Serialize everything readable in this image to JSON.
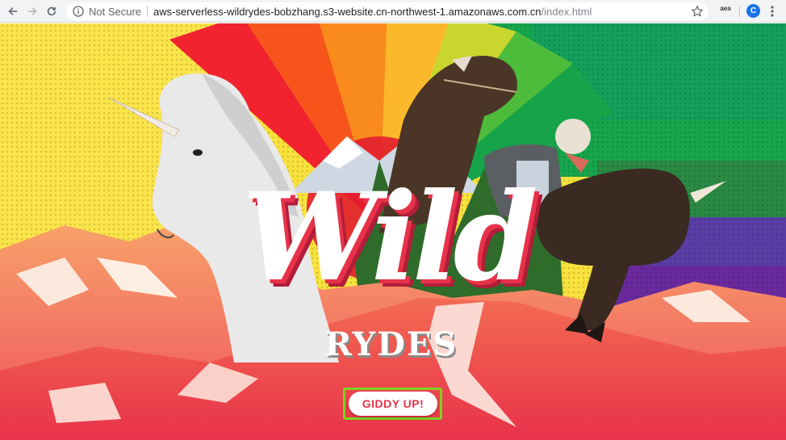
{
  "browser": {
    "security_label": "Not Secure",
    "url_host": "aws-serverless-wildrydes-bobzhang.s3-website.cn-northwest-1.amazonaws.com.cn",
    "url_path": "/index.html",
    "extension_label": "aea",
    "avatar_initial": "C",
    "icons": [
      "back-icon",
      "forward-icon",
      "reload-icon",
      "info-icon",
      "star-icon",
      "menu-icon"
    ]
  },
  "hero": {
    "logo_script": "Wild",
    "logo_sub": "RYDES",
    "cta_label": "GIDDY UP!",
    "colors": {
      "accent": "#e8324a",
      "cta_focus_outline": "#7dd321",
      "sky_yellow": "#f7e234",
      "sky_green": "#1aa84a",
      "sky_purple": "#6a2a9e",
      "mountain_coral": "#f07a55"
    }
  }
}
